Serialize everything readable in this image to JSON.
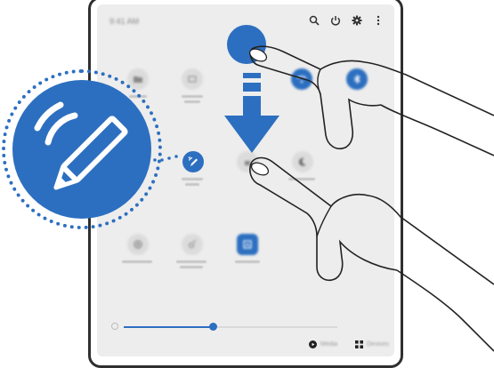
{
  "status": {
    "time": "9:41 AM"
  },
  "header_icons": [
    "search-icon",
    "power-icon",
    "gear-icon",
    "more-icon"
  ],
  "tiles": [
    {
      "name": "tile-file",
      "icon": "folder-icon",
      "on": false
    },
    {
      "name": "tile-screen-capture",
      "icon": "capture-icon",
      "on": false
    },
    {
      "name": "tile-wifi",
      "icon": "wifi-icon",
      "on": true
    },
    {
      "name": "tile-bluetooth",
      "icon": "bluetooth-icon",
      "on": true
    },
    {
      "name": "tile-pen-write",
      "icon": "pen-wifi-icon",
      "on": true
    },
    {
      "name": "tile-lock",
      "icon": "lock-icon",
      "on": false
    },
    {
      "name": "tile-night",
      "icon": "moon-icon",
      "on": false
    },
    {
      "name": "tile-hotspot",
      "icon": "hotspot-icon",
      "on": false
    },
    {
      "name": "tile-smart-view",
      "icon": "cast-icon",
      "on": false
    },
    {
      "name": "tile-quick-share",
      "icon": "share-icon",
      "on": true
    }
  ],
  "bottom": {
    "media_label": "Media",
    "devices_label": "Devices"
  },
  "colors": {
    "accent": "#2c6fc0",
    "panel": "#ededed",
    "outline": "#2f2f2f"
  }
}
